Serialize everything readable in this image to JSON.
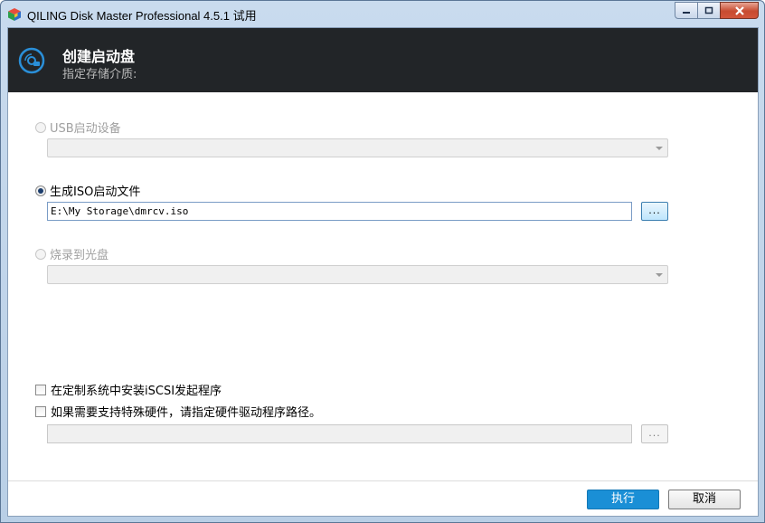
{
  "window": {
    "title": "QILING Disk Master Professional 4.5.1 试用"
  },
  "header": {
    "title": "创建启动盘",
    "subtitle": "指定存储介质:"
  },
  "options": {
    "usb": {
      "label": "USB启动设备",
      "selected": false,
      "enabled": false
    },
    "iso": {
      "label": "生成ISO启动文件",
      "selected": true,
      "enabled": true,
      "path": "E:\\My Storage\\dmrcv.iso",
      "browse_label": "..."
    },
    "disc": {
      "label": "烧录到光盘",
      "selected": false,
      "enabled": false
    }
  },
  "checks": {
    "iscsi": {
      "label": "在定制系统中安装iSCSI发起程序",
      "checked": false
    },
    "drivers": {
      "label": "如果需要支持特殊硬件，请指定硬件驱动程序路径。",
      "checked": false,
      "path": "",
      "browse_label": "..."
    }
  },
  "footer": {
    "execute_label": "执行",
    "cancel_label": "取消"
  },
  "colors": {
    "header_bg": "#222528",
    "primary_button": "#1a8fd6"
  }
}
